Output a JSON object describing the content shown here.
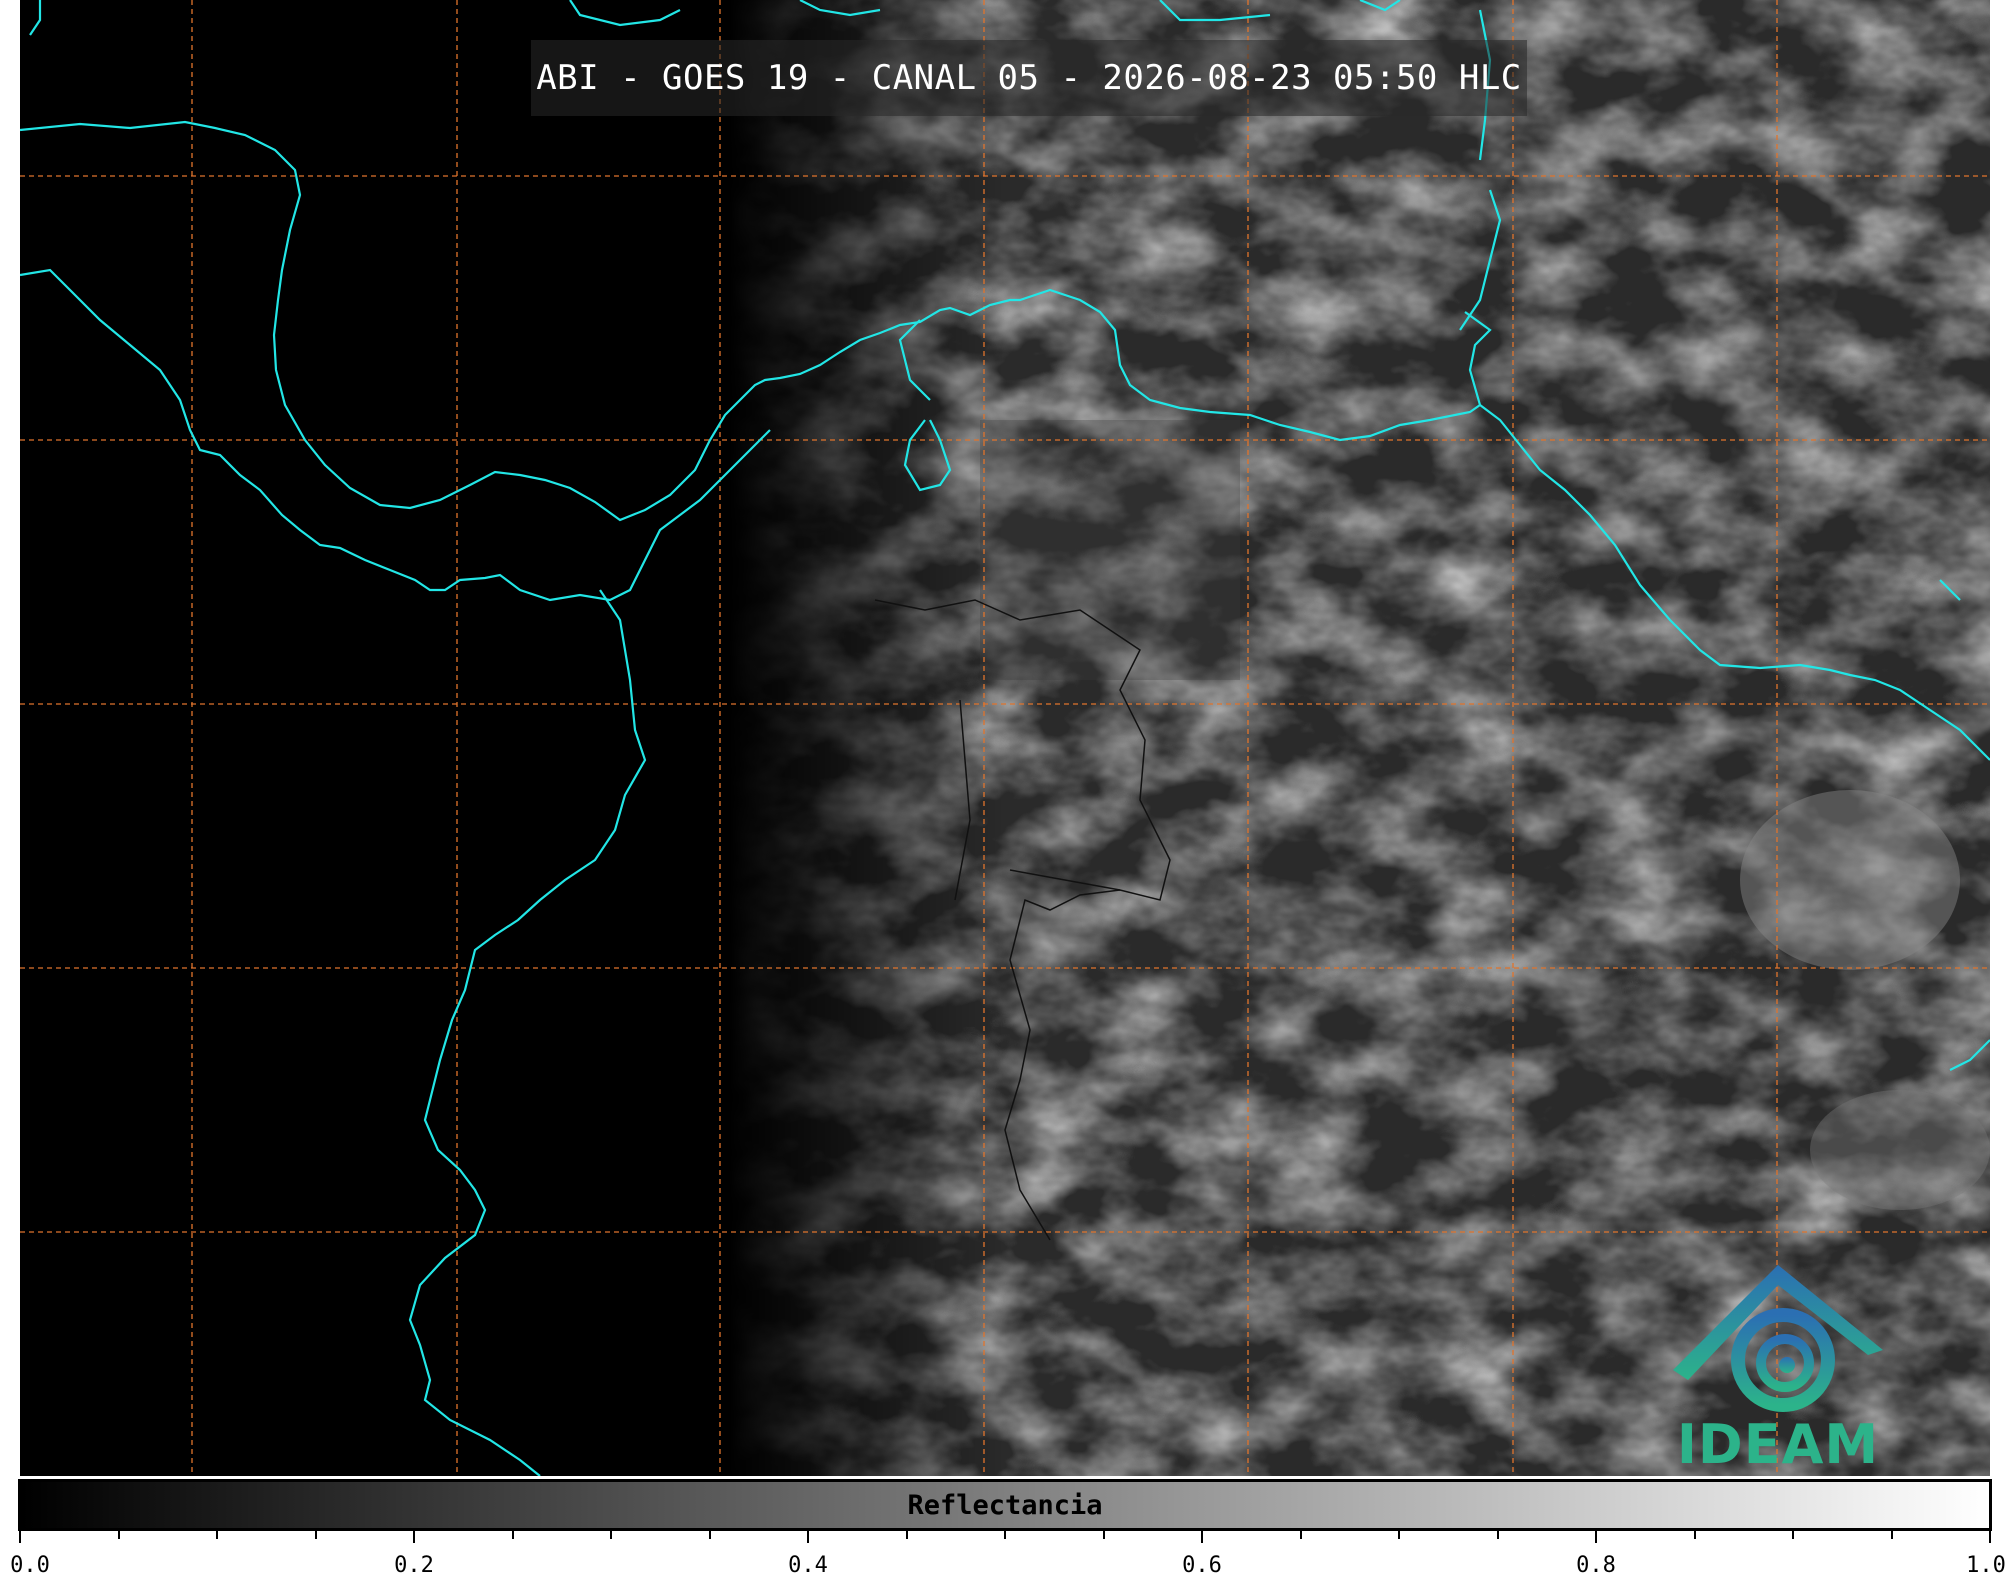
{
  "title": "ABI - GOES 19 - CANAL 05 - 2026-08-23 05:50 HLC",
  "logo": {
    "text": "IDEAM",
    "icon": "ideam-swirl-mountain-logo"
  },
  "colorbar": {
    "label": "Reflectancia",
    "min": 0.0,
    "max": 1.0,
    "gradient": [
      "#000000",
      "#ffffff"
    ],
    "tick_labels": [
      "0.0",
      "0.2",
      "0.4",
      "0.6",
      "0.8",
      "1.0"
    ],
    "major_ticks": [
      0.0,
      0.2,
      0.4,
      0.6,
      0.8,
      1.0
    ],
    "minor_step": 0.05
  },
  "map": {
    "grid": true,
    "grid_color": "#e0742c",
    "coastline_color": "#22e6e6",
    "border_color": "#111111",
    "background_color": "#000000"
  }
}
